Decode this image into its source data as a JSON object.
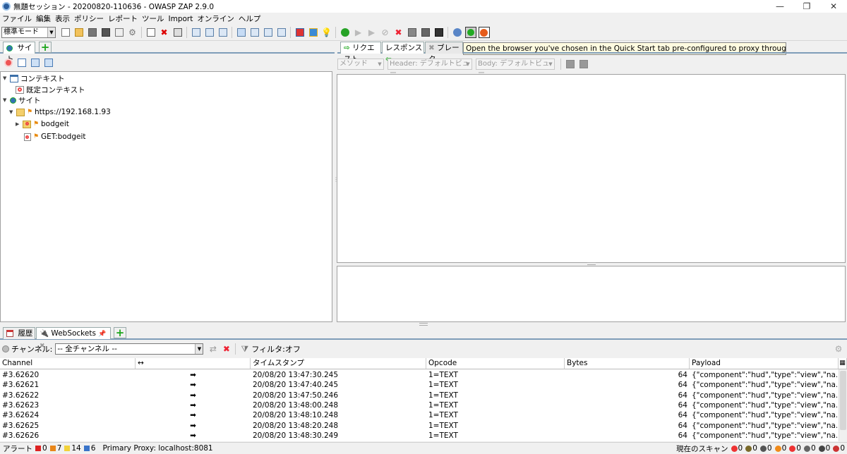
{
  "window": {
    "title": "無題セッション - 20200820-110636 - OWASP ZAP 2.9.0",
    "minimize": "—",
    "maximize": "❐",
    "close": "✕"
  },
  "menu": [
    "ファイル",
    "編集",
    "表示",
    "ポリシー",
    "レポート",
    "ツール",
    "Import",
    "オンライン",
    "ヘルプ"
  ],
  "toolbar": {
    "mode": "標準モード"
  },
  "tooltip": "Open the browser you've chosen in the Quick Start tab pre-configured to proxy through ZAP",
  "left": {
    "tab_sites": "サイト",
    "tree": {
      "contexts": "コンテキスト",
      "default_context": "既定コンテキスト",
      "sites": "サイト",
      "host": "https://192.168.1.93",
      "folder": "bodgeit",
      "get": "GET:bodgeit"
    }
  },
  "right": {
    "tab_request": "リクエスト",
    "tab_response": "レスポンス",
    "tab_break": "ブレーク",
    "method": "メソッド",
    "header_view": "Header: デフォルトビュー",
    "body_view": "Body: デフォルトビュー"
  },
  "bottom": {
    "tab_history": "履歴",
    "tab_websockets": "WebSockets",
    "channel_label": "チャンネル:",
    "channel_value": "-- 全チャンネル --",
    "filter": "フィルタ:オフ",
    "columns": [
      "Channel",
      "↔",
      "タイムスタンプ",
      "Opcode",
      "Bytes",
      "Payload"
    ],
    "rows": [
      {
        "channel": "#3.62620",
        "dir": "➡",
        "ts": "20/08/20 13:47:30.245",
        "opcode": "1=TEXT",
        "bytes": "64",
        "payload": "{\"component\":\"hud\",\"type\":\"view\",\"na..."
      },
      {
        "channel": "#3.62621",
        "dir": "➡",
        "ts": "20/08/20 13:47:40.245",
        "opcode": "1=TEXT",
        "bytes": "64",
        "payload": "{\"component\":\"hud\",\"type\":\"view\",\"na..."
      },
      {
        "channel": "#3.62622",
        "dir": "➡",
        "ts": "20/08/20 13:47:50.246",
        "opcode": "1=TEXT",
        "bytes": "64",
        "payload": "{\"component\":\"hud\",\"type\":\"view\",\"na..."
      },
      {
        "channel": "#3.62623",
        "dir": "➡",
        "ts": "20/08/20 13:48:00.248",
        "opcode": "1=TEXT",
        "bytes": "64",
        "payload": "{\"component\":\"hud\",\"type\":\"view\",\"na..."
      },
      {
        "channel": "#3.62624",
        "dir": "➡",
        "ts": "20/08/20 13:48:10.248",
        "opcode": "1=TEXT",
        "bytes": "64",
        "payload": "{\"component\":\"hud\",\"type\":\"view\",\"na..."
      },
      {
        "channel": "#3.62625",
        "dir": "➡",
        "ts": "20/08/20 13:48:20.248",
        "opcode": "1=TEXT",
        "bytes": "64",
        "payload": "{\"component\":\"hud\",\"type\":\"view\",\"na..."
      },
      {
        "channel": "#3.62626",
        "dir": "➡",
        "ts": "20/08/20 13:48:30.249",
        "opcode": "1=TEXT",
        "bytes": "64",
        "payload": "{\"component\":\"hud\",\"type\":\"view\",\"na..."
      }
    ]
  },
  "status": {
    "alerts_label": "アラート",
    "alert_high": "0",
    "alert_medium": "7",
    "alert_low": "14",
    "alert_info": "6",
    "proxy": "Primary Proxy: localhost:8081",
    "scans_label": "現在のスキャン",
    "scan_counts": [
      "0",
      "0",
      "0",
      "0",
      "0",
      "0",
      "0",
      "0"
    ]
  }
}
